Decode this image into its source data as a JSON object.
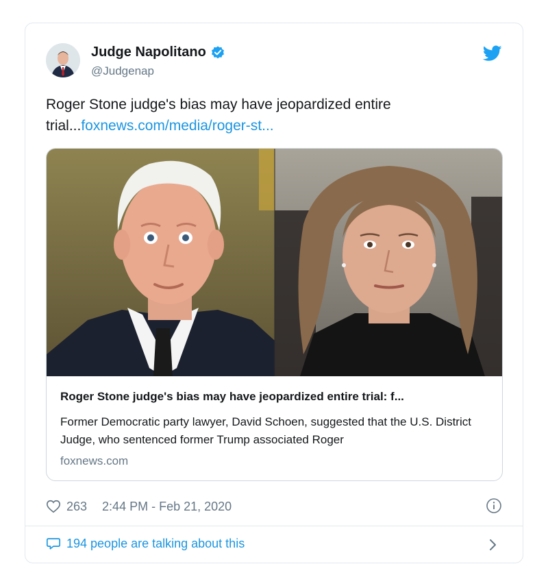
{
  "tweet": {
    "author_name": "Judge Napolitano",
    "handle": "@Judgenap",
    "text": "Roger Stone judge's bias may have jeopardized entire trial...",
    "link_text": "foxnews.com/media/roger-st...",
    "likes": "263",
    "timestamp": "2:44 PM - Feb 21, 2020",
    "conversation": "194 people are talking about this"
  },
  "link_card": {
    "title": "Roger Stone judge's bias may have jeopardized entire trial: f...",
    "description": "Former Democratic party lawyer, David Schoen, suggested that the U.S. District Judge, who sentenced former Trump associated Roger",
    "domain": "foxnews.com"
  },
  "icons": {
    "verified": "verified-badge-icon",
    "brand": "twitter-bird-icon",
    "like": "heart-icon",
    "info": "info-icon",
    "reply": "speech-bubble-icon",
    "more": "chevron-right-icon"
  },
  "colors": {
    "accent": "#1b95e0",
    "secondary_text": "#657786",
    "border": "#e1e8ed"
  }
}
